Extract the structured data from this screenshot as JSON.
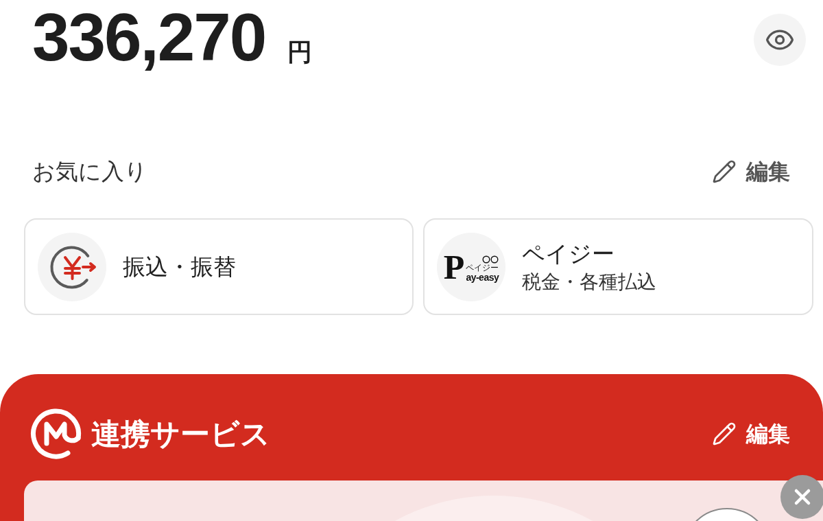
{
  "balance": {
    "amount": "336,270",
    "unit": "円"
  },
  "favorites": {
    "title": "お気に入り",
    "edit_label": "編集",
    "items": [
      {
        "kind": "transfer",
        "title": "振込・振替"
      },
      {
        "kind": "payeasy",
        "title": "ペイジー",
        "subtitle": "税金・各種払込",
        "logo_initial": "P",
        "logo_ruby": "ペイジー",
        "logo_wordmark": "ay-easy"
      }
    ]
  },
  "linked_services": {
    "title": "連携サービス",
    "edit_label": "編集"
  }
}
